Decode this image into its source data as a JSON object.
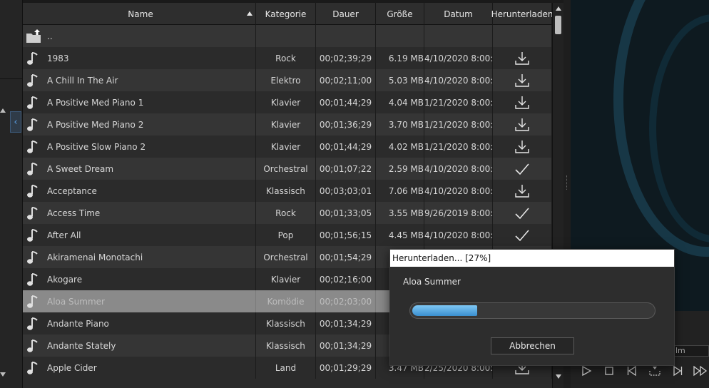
{
  "table": {
    "columns": {
      "name": "Name",
      "category": "Kategorie",
      "duration": "Dauer",
      "size": "Größe",
      "date": "Datum",
      "download": "Herunterladen"
    },
    "parent_row_label": "..",
    "rows": [
      {
        "name": "1983",
        "category": "Rock",
        "duration": "00;02;39;29",
        "size": "6.19 MB",
        "date": "4/10/2020 8:00:0...",
        "status": "download"
      },
      {
        "name": "A Chill In The Air",
        "category": "Elektro",
        "duration": "00;02;11;00",
        "size": "5.03 MB",
        "date": "4/10/2020 8:00:0...",
        "status": "download"
      },
      {
        "name": "A Positive Med Piano 1",
        "category": "Klavier",
        "duration": "00;01;44;29",
        "size": "4.04 MB",
        "date": "1/21/2020 8:00:0...",
        "status": "download"
      },
      {
        "name": "A Positive Med Piano 2",
        "category": "Klavier",
        "duration": "00;01;36;29",
        "size": "3.70 MB",
        "date": "1/21/2020 8:00:0...",
        "status": "download"
      },
      {
        "name": "A Positive Slow Piano 2",
        "category": "Klavier",
        "duration": "00;01;44;29",
        "size": "4.02 MB",
        "date": "1/21/2020 8:00:0...",
        "status": "download"
      },
      {
        "name": "A Sweet Dream",
        "category": "Orchestral",
        "duration": "00;01;07;22",
        "size": "2.59 MB",
        "date": "4/10/2020 8:00:0...",
        "status": "done"
      },
      {
        "name": "Acceptance",
        "category": "Klassisch",
        "duration": "00;03;03;01",
        "size": "7.06 MB",
        "date": "4/10/2020 8:00:0...",
        "status": "download"
      },
      {
        "name": "Access Time",
        "category": "Rock",
        "duration": "00;01;33;05",
        "size": "3.55 MB",
        "date": "9/26/2019 8:00:0...",
        "status": "done"
      },
      {
        "name": "After All",
        "category": "Pop",
        "duration": "00;01;56;15",
        "size": "4.45 MB",
        "date": "4/10/2020 8:00:0...",
        "status": "done"
      },
      {
        "name": "Akiramenai Monotachi",
        "category": "Orchestral",
        "duration": "00;01;54;29",
        "size": "",
        "date": "",
        "status": ""
      },
      {
        "name": "Akogare",
        "category": "Klavier",
        "duration": "00;02;16;00",
        "size": "",
        "date": "",
        "status": ""
      },
      {
        "name": "Aloa Summer",
        "category": "Komödie",
        "duration": "00;02;03;00",
        "size": "",
        "date": "",
        "status": ""
      },
      {
        "name": "Andante Piano",
        "category": "Klassisch",
        "duration": "00;01;34;29",
        "size": "",
        "date": "",
        "status": ""
      },
      {
        "name": "Andante Stately",
        "category": "Klassisch",
        "duration": "00;01;34;29",
        "size": "",
        "date": "",
        "status": ""
      },
      {
        "name": "Apple Cider",
        "category": "Land",
        "duration": "00;01;29;29",
        "size": "3.47 MB",
        "date": "2/25/2020 8:00:0...",
        "status": "download"
      }
    ],
    "selected_row": "Aloa Summer"
  },
  "player": {
    "field_text": "lm"
  },
  "dialog": {
    "title": "Herunterladen... [27%]",
    "file_name": "Aloa Summer",
    "progress_percent": 27,
    "cancel_label": "Abbrechen"
  },
  "colors": {
    "accent_blue": "#3a8fd0",
    "selected_row": "#8a8a8a"
  }
}
